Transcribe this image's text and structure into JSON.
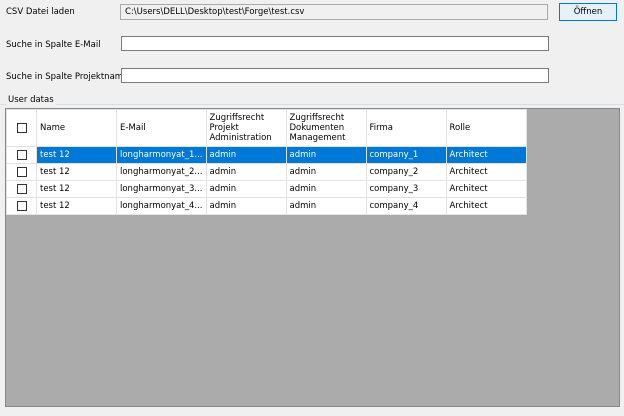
{
  "form": {
    "csv_label": "CSV Datei laden",
    "csv_path": "C:\\Users\\DELL\\Desktop\\test\\Forge\\test.csv",
    "open_button": "Öffnen",
    "search_email_label": "Suche in Spalte E-Mail",
    "search_email_value": "",
    "search_project_label": "Suche in Spalte Projektname",
    "search_project_value": ""
  },
  "group": {
    "title": "User datas"
  },
  "grid": {
    "columns": [
      "Name",
      "E-Mail",
      "Zugriffsrecht Projekt Administration",
      "Zugriffsrecht Dokumenten Management",
      "Firma",
      "Rolle"
    ],
    "rows": [
      [
        "test 12",
        "longharmonyat_1...",
        "admin",
        "admin",
        "company_1",
        "Architect"
      ],
      [
        "test 12",
        "longharmonyat_2...",
        "admin",
        "admin",
        "company_2",
        "Architect"
      ],
      [
        "test 12",
        "longharmonyat_3...",
        "admin",
        "admin",
        "company_3",
        "Architect"
      ],
      [
        "test 12",
        "longharmonyat_4...",
        "admin",
        "admin",
        "company_4",
        "Architect"
      ]
    ],
    "selected_row": 0
  },
  "colors": {
    "selection": "#0078d7",
    "grid_background": "#ababab",
    "window_background": "#f0f0f0"
  }
}
